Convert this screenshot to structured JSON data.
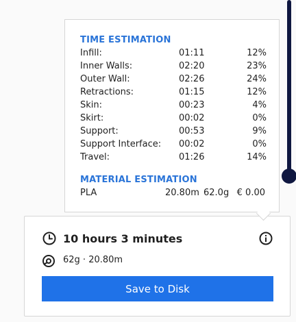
{
  "time_estimation": {
    "title": "TIME ESTIMATION",
    "rows": [
      {
        "label": "Infill:",
        "time": "01:11",
        "percent": "12%"
      },
      {
        "label": "Inner Walls:",
        "time": "02:20",
        "percent": "23%"
      },
      {
        "label": "Outer Wall:",
        "time": "02:26",
        "percent": "24%"
      },
      {
        "label": "Retractions:",
        "time": "01:15",
        "percent": "12%"
      },
      {
        "label": "Skin:",
        "time": "00:23",
        "percent": "4%"
      },
      {
        "label": "Skirt:",
        "time": "00:02",
        "percent": "0%"
      },
      {
        "label": "Support:",
        "time": "00:53",
        "percent": "9%"
      },
      {
        "label": "Support Interface:",
        "time": "00:02",
        "percent": "0%"
      },
      {
        "label": "Travel:",
        "time": "01:26",
        "percent": "14%"
      }
    ]
  },
  "material_estimation": {
    "title": "MATERIAL ESTIMATION",
    "rows": [
      {
        "material": "PLA",
        "length": "20.80m",
        "weight": "62.0g",
        "cost": "€ 0.00"
      }
    ]
  },
  "summary": {
    "print_time": "10 hours 3 minutes",
    "material": "62g · 20.80m",
    "save_label": "Save to Disk"
  },
  "colors": {
    "accent": "#1f72e8",
    "section_title": "#2a74d8",
    "slider": "#0f1740"
  },
  "icons": {
    "time": "clock-icon",
    "info": "info-icon",
    "material": "spool-icon"
  }
}
